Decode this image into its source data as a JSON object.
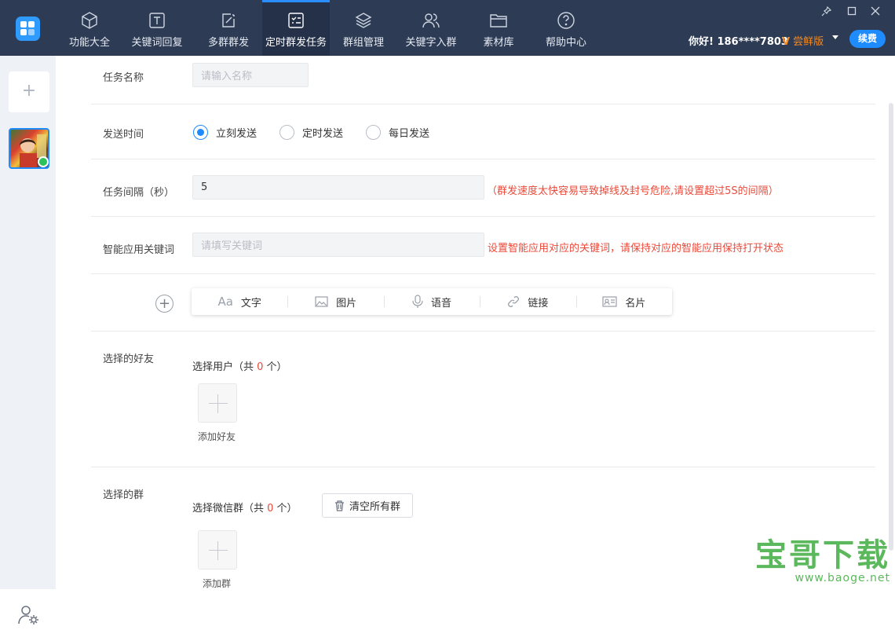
{
  "nav": {
    "items": [
      {
        "label": "功能大全",
        "icon": "cube-icon"
      },
      {
        "label": "关键词回复",
        "icon": "text-t-icon"
      },
      {
        "label": "多群群发",
        "icon": "edit-icon"
      },
      {
        "label": "定时群发任务",
        "icon": "task-list-icon",
        "active": true
      },
      {
        "label": "群组管理",
        "icon": "layers-icon"
      },
      {
        "label": "关键字入群",
        "icon": "users-icon"
      },
      {
        "label": "素材库",
        "icon": "folder-icon"
      },
      {
        "label": "帮助中心",
        "icon": "help-icon"
      }
    ]
  },
  "header": {
    "greeting": "你好! 186****7803",
    "version": "尝鲜版",
    "renew": "续费"
  },
  "sidebar": {
    "add_symbol": "+"
  },
  "form": {
    "task_name": {
      "label": "任务名称",
      "placeholder": "请输入名称"
    },
    "send_time": {
      "label": "发送时间",
      "options": [
        "立刻发送",
        "定时发送",
        "每日发送"
      ],
      "selected": "立刻发送"
    },
    "interval": {
      "label": "任务间隔（秒）",
      "value": "5",
      "hint": "（群发速度太快容易导致掉线及封号危险,请设置超过5S的间隔）"
    },
    "keyword": {
      "label": "智能应用关键词",
      "placeholder": "请填写关键词",
      "hint": "设置智能应用对应的关键词，请保持对应的智能应用保持打开状态"
    },
    "content_tools": [
      {
        "label": "文字",
        "icon": "text-aa-icon"
      },
      {
        "label": "图片",
        "icon": "image-icon"
      },
      {
        "label": "语音",
        "icon": "microphone-icon"
      },
      {
        "label": "链接",
        "icon": "link-icon"
      },
      {
        "label": "名片",
        "icon": "contact-card-icon"
      }
    ],
    "friends": {
      "label": "选择的好友",
      "prefix": "选择用户（共 ",
      "count": "0",
      "suffix": " 个）",
      "add": "添加好友"
    },
    "groups": {
      "label": "选择的群",
      "prefix": "选择微信群（共 ",
      "count": "0",
      "suffix": " 个）",
      "clear": "清空所有群",
      "add": "添加群"
    }
  },
  "watermark": {
    "title": "宝哥下载",
    "url": "www.baoge.net"
  },
  "colors": {
    "topbar": "#2d3b54",
    "accent": "#1e8cff",
    "warning": "#ea4a3a",
    "vip": "#f08a24"
  }
}
